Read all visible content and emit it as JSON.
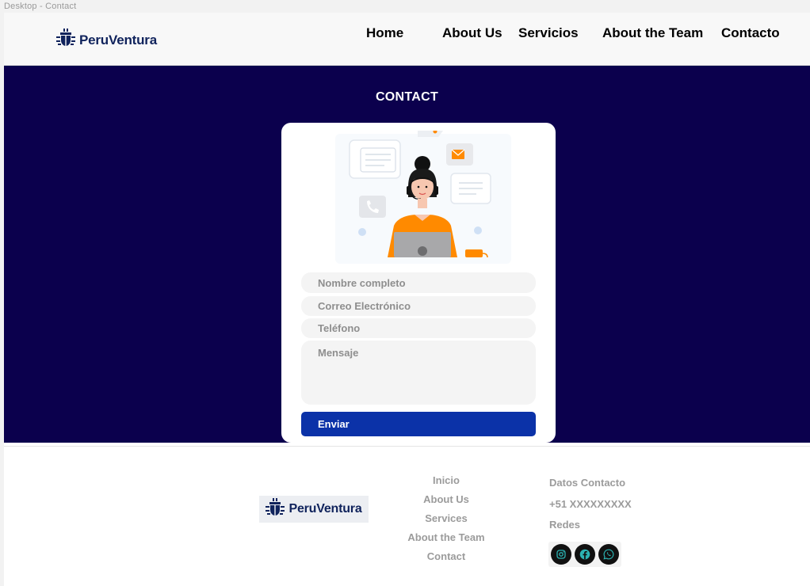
{
  "frame_label": "Desktop - Contact",
  "header": {
    "brand": "PeruVentura",
    "nav": [
      "Home",
      "About Us",
      "Servicios",
      "About the Team",
      "Contacto"
    ]
  },
  "contact": {
    "title": "CONTACT",
    "fields": {
      "name_placeholder": "Nombre completo",
      "email_placeholder": "Correo Electrónico",
      "phone_placeholder": "Teléfono",
      "message_placeholder": "Mensaje"
    },
    "submit_label": "Enviar"
  },
  "footer": {
    "brand": "PeruVentura",
    "links": [
      "Inicio",
      "About Us",
      "Services",
      "About the Team",
      "Contact"
    ],
    "contact_heading": "Datos Contacto",
    "phone": "+51 XXXXXXXXX",
    "social_heading": "Redes",
    "socials": [
      "instagram-icon",
      "facebook-icon",
      "whatsapp-icon"
    ]
  },
  "colors": {
    "hero_bg": "#0b004d",
    "brand_text": "#10235c",
    "button": "#0b32a8",
    "illustration_accent": "#ff8a00"
  }
}
